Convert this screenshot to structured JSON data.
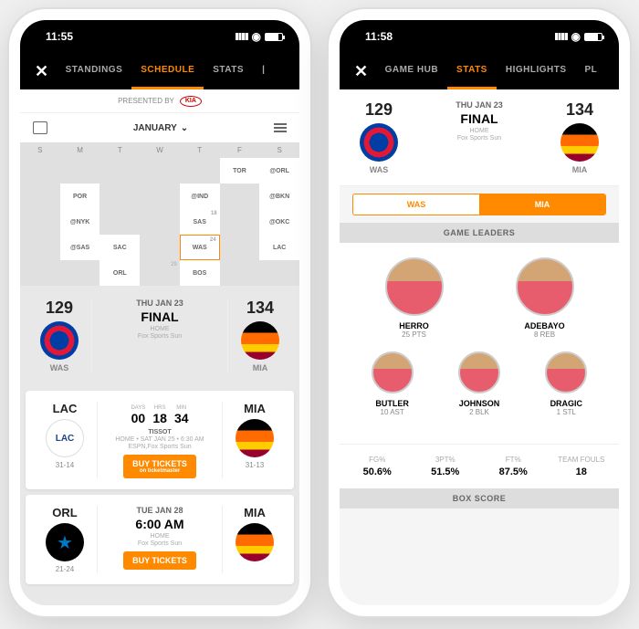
{
  "phone1": {
    "time": "11:55",
    "tabs": [
      "STANDINGS",
      "SCHEDULE",
      "STATS"
    ],
    "activeTab": 1,
    "presented": "PRESENTED BY",
    "sponsor": "KIA",
    "month": "JANUARY",
    "weekdays": [
      "S",
      "M",
      "T",
      "W",
      "T",
      "F",
      "S"
    ],
    "calendar": [
      [
        "",
        "",
        "",
        "",
        "",
        "TOR",
        "@ORL"
      ],
      [
        "",
        "POR",
        "",
        "",
        "@IND",
        "",
        "@BKN"
      ],
      [
        "",
        "@NYK",
        "",
        "",
        "SAS",
        "",
        "@OKC"
      ],
      [
        "",
        "@SAS",
        "SAC",
        "",
        "WAS",
        "",
        "LAC"
      ],
      [
        "",
        "",
        "ORL",
        "",
        "BOS",
        "",
        ""
      ]
    ],
    "calDays": [
      [
        "",
        "",
        "",
        "",
        "",
        "",
        ""
      ],
      [
        "",
        "",
        "",
        "",
        "",
        "",
        ""
      ],
      [
        "",
        "",
        "",
        "",
        "18",
        "",
        " "
      ],
      [
        "",
        "",
        "",
        "",
        "24",
        "",
        ""
      ],
      [
        "",
        "",
        "",
        "29",
        "",
        "",
        ""
      ]
    ],
    "featured": {
      "away": {
        "score": "129",
        "abbr": "WAS"
      },
      "home": {
        "score": "134",
        "abbr": "MIA"
      },
      "date": "THU JAN 23",
      "status": "FINAL",
      "loc": "HOME",
      "tv": "Fox Sports Sun"
    },
    "games": [
      {
        "away": {
          "abbr": "LAC",
          "rec": "31-14"
        },
        "home": {
          "abbr": "MIA",
          "rec": "31-13"
        },
        "countdown": {
          "days": "00",
          "hrs": "18",
          "min": "34"
        },
        "presenter": "TISSOT",
        "info": "HOME • SAT JAN 25 • 6:30 AM",
        "tv": "ESPN,Fox Sports Sun",
        "cta": "BUY TICKETS",
        "ctaSub": "on ticketmaster"
      },
      {
        "away": {
          "abbr": "ORL",
          "rec": "21-24"
        },
        "home": {
          "abbr": "MIA",
          "rec": ""
        },
        "date": "TUE JAN 28",
        "time": "6:00 AM",
        "loc": "HOME",
        "tv": "Fox Sports Sun",
        "cta": "BUY TICKETS"
      }
    ]
  },
  "phone2": {
    "time": "11:58",
    "tabs": [
      "GAME HUB",
      "STATS",
      "HIGHLIGHTS",
      "PL"
    ],
    "activeTab": 1,
    "header": {
      "away": {
        "score": "129",
        "abbr": "WAS"
      },
      "home": {
        "score": "134",
        "abbr": "MIA"
      },
      "date": "THU JAN 23",
      "status": "FINAL",
      "loc": "HOME",
      "tv": "Fox Sports Sun"
    },
    "toggle": [
      "WAS",
      "MIA"
    ],
    "toggleActive": 1,
    "leadersTitle": "GAME LEADERS",
    "leaders": [
      {
        "name": "HERRO",
        "stat": "25 PTS"
      },
      {
        "name": "ADEBAYO",
        "stat": "8 REB"
      },
      {
        "name": "BUTLER",
        "stat": "10 AST"
      },
      {
        "name": "JOHNSON",
        "stat": "2 BLK"
      },
      {
        "name": "DRAGIC",
        "stat": "1 STL"
      }
    ],
    "teamStats": [
      {
        "lbl": "FG%",
        "val": "50.6%"
      },
      {
        "lbl": "3PT%",
        "val": "51.5%"
      },
      {
        "lbl": "FT%",
        "val": "87.5%"
      },
      {
        "lbl": "TEAM FOULS",
        "val": "18"
      }
    ],
    "boxScore": "BOX SCORE"
  },
  "countdownLabels": {
    "days": "DAYS",
    "hrs": "HRS",
    "min": "MIN"
  }
}
